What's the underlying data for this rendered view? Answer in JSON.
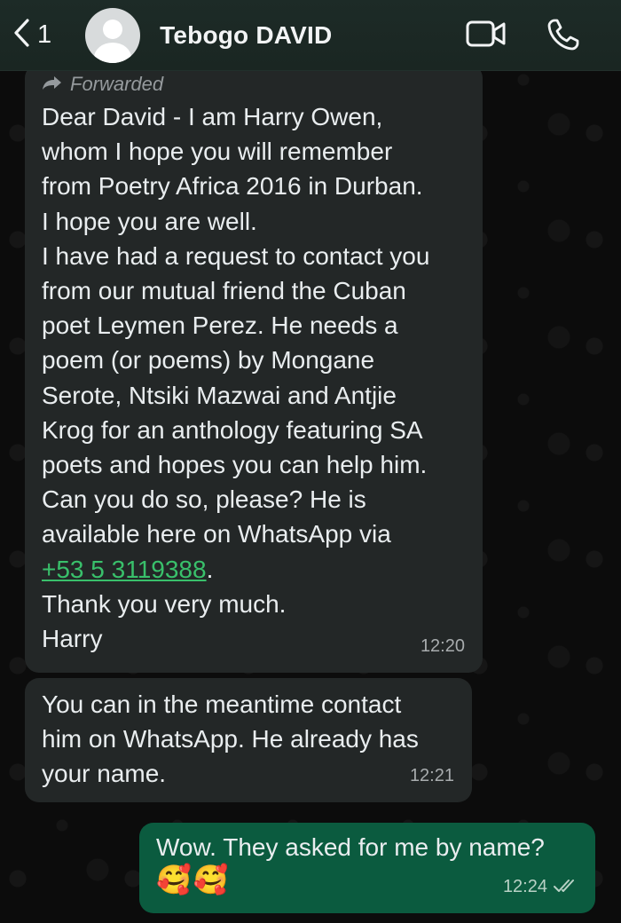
{
  "header": {
    "back_count": "1",
    "contact_name": "Tebogo DAVID",
    "icons": [
      "chevron-left-icon",
      "avatar-icon",
      "video-call-icon",
      "phone-call-icon"
    ]
  },
  "messages": [
    {
      "direction": "incoming",
      "forwarded_label": "Forwarded",
      "text_before_link": "Dear David - I am Harry Owen,\nwhom I hope you will remember\nfrom Poetry Africa 2016 in Durban.\nI hope you are well.\nI have had a request to contact you\nfrom our mutual friend the Cuban\npoet Leymen Perez. He needs a\npoem (or poems) by Mongane\nSerote, Ntsiki Mazwai and Antjie\nKrog for an anthology featuring SA\npoets and hopes you can help him.\nCan you do so, please?  He is\navailable here on WhatsApp via\n",
      "link": "+53 5 3119388",
      "text_after_link": ".\nThank you very much.\nHarry",
      "time": "12:20"
    },
    {
      "direction": "incoming",
      "text": "You can in the meantime contact\nhim on WhatsApp. He already has\nyour name.",
      "time": "12:21"
    },
    {
      "direction": "outgoing",
      "text": "Wow. They asked for me by name?",
      "emojis": [
        "🥰",
        "🥰"
      ],
      "time": "12:24",
      "status": "read-double-check-icon"
    }
  ],
  "colors": {
    "header_bg": "#1a2622",
    "incoming_bubble": "#232727",
    "outgoing_bubble": "#0b5b3f",
    "link": "#39c06b"
  }
}
